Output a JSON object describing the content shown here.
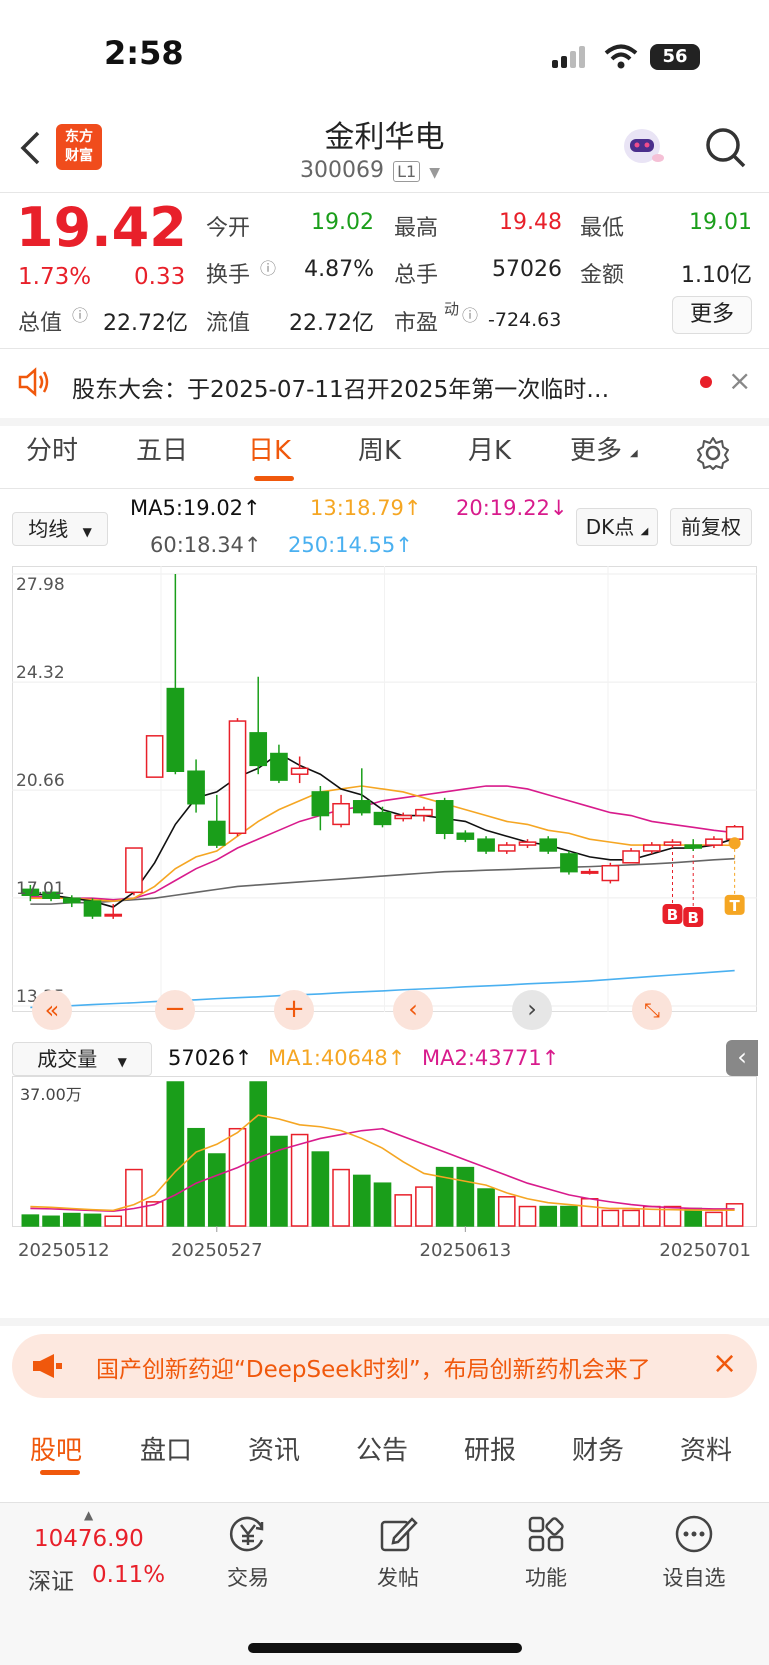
{
  "status_bar": {
    "time": "2:58",
    "battery": "56"
  },
  "header": {
    "title": "金利华电",
    "code": "300069",
    "level": "L1",
    "logo_top": "东方",
    "logo_bottom": "财富"
  },
  "quote": {
    "price": "19.42",
    "change_pct": "1.73%",
    "change": "0.33",
    "open_label": "今开",
    "open": "19.02",
    "high_label": "最高",
    "high": "19.48",
    "low_label": "最低",
    "low": "19.01",
    "turnover_label": "换手",
    "turnover": "4.87%",
    "volume_label": "总手",
    "volume": "57026",
    "amount_label": "金额",
    "amount": "1.10亿",
    "mktcap_label": "总值",
    "mktcap": "22.72亿",
    "float_label": "流值",
    "float_cap": "22.72亿",
    "pe_label": "市盈",
    "pe_sup": "动",
    "pe": "-724.63",
    "more": "更多"
  },
  "notice": {
    "text": "股东大会：于2025-07-11召开2025年第一次临时…"
  },
  "period_tabs": [
    "分时",
    "五日",
    "日K",
    "周K",
    "月K",
    "更多"
  ],
  "ma_controls": {
    "selector": "均线",
    "ma5": "MA5:19.02↑",
    "ma13": "13:18.79↑",
    "ma20": "20:19.22↓",
    "ma60": "60:18.34↑",
    "ma250": "250:14.55↑",
    "dk": "DK点",
    "fq": "前复权"
  },
  "colors": {
    "up": "#e8202a",
    "down": "#1a9e1a",
    "accent": "#f0580c",
    "ma5": "#111111",
    "ma13": "#f5a623",
    "ma20": "#d81b8c",
    "ma60": "#666666",
    "ma250": "#4ab0f0"
  },
  "chart_data": {
    "type": "candlestick",
    "y_ticks": [
      "27.98",
      "24.32",
      "20.66",
      "17.01",
      "13.35"
    ],
    "ylim": [
      13.35,
      27.98
    ],
    "date_labels": [
      "20250512",
      "20250527",
      "20250613",
      "20250701"
    ],
    "candles": [
      {
        "o": 17.3,
        "c": 17.1,
        "h": 17.45,
        "l": 16.9
      },
      {
        "o": 17.2,
        "c": 17.0,
        "h": 17.3,
        "l": 16.9
      },
      {
        "o": 17.0,
        "c": 16.85,
        "h": 17.1,
        "l": 16.7
      },
      {
        "o": 16.9,
        "c": 16.4,
        "h": 17.0,
        "l": 16.3
      },
      {
        "o": 16.4,
        "c": 16.45,
        "h": 16.8,
        "l": 16.3
      },
      {
        "o": 17.2,
        "c": 18.7,
        "h": 18.7,
        "l": 17.1
      },
      {
        "o": 21.1,
        "c": 22.5,
        "h": 22.5,
        "l": 21.1
      },
      {
        "o": 24.1,
        "c": 21.3,
        "h": 27.98,
        "l": 21.2
      },
      {
        "o": 21.3,
        "c": 20.2,
        "h": 21.7,
        "l": 19.9
      },
      {
        "o": 19.6,
        "c": 18.8,
        "h": 20.5,
        "l": 18.7
      },
      {
        "o": 19.2,
        "c": 23.0,
        "h": 23.1,
        "l": 19.1
      },
      {
        "o": 22.6,
        "c": 21.5,
        "h": 24.5,
        "l": 21.2
      },
      {
        "o": 21.9,
        "c": 21.0,
        "h": 22.2,
        "l": 20.9
      },
      {
        "o": 21.2,
        "c": 21.4,
        "h": 21.8,
        "l": 20.9
      },
      {
        "o": 20.6,
        "c": 19.8,
        "h": 20.8,
        "l": 19.3
      },
      {
        "o": 19.5,
        "c": 20.2,
        "h": 20.5,
        "l": 19.4
      },
      {
        "o": 20.3,
        "c": 19.9,
        "h": 21.4,
        "l": 19.8
      },
      {
        "o": 19.9,
        "c": 19.5,
        "h": 20.1,
        "l": 19.4
      },
      {
        "o": 19.7,
        "c": 19.8,
        "h": 19.9,
        "l": 19.6
      },
      {
        "o": 19.8,
        "c": 20.0,
        "h": 20.1,
        "l": 19.6
      },
      {
        "o": 20.3,
        "c": 19.2,
        "h": 20.4,
        "l": 19.0
      },
      {
        "o": 19.2,
        "c": 19.0,
        "h": 19.3,
        "l": 18.9
      },
      {
        "o": 19.0,
        "c": 18.6,
        "h": 19.1,
        "l": 18.5
      },
      {
        "o": 18.6,
        "c": 18.8,
        "h": 18.9,
        "l": 18.5
      },
      {
        "o": 18.8,
        "c": 18.9,
        "h": 19.0,
        "l": 18.7
      },
      {
        "o": 19.0,
        "c": 18.6,
        "h": 19.1,
        "l": 18.5
      },
      {
        "o": 18.5,
        "c": 17.9,
        "h": 18.6,
        "l": 17.8
      },
      {
        "o": 17.9,
        "c": 17.9,
        "h": 18.0,
        "l": 17.8
      },
      {
        "o": 17.6,
        "c": 18.1,
        "h": 18.2,
        "l": 17.5
      },
      {
        "o": 18.2,
        "c": 18.6,
        "h": 18.7,
        "l": 18.2
      },
      {
        "o": 18.6,
        "c": 18.8,
        "h": 18.9,
        "l": 18.5
      },
      {
        "o": 18.8,
        "c": 18.9,
        "h": 19.0,
        "l": 18.7
      },
      {
        "o": 18.8,
        "c": 18.7,
        "h": 19.0,
        "l": 18.6
      },
      {
        "o": 18.8,
        "c": 19.0,
        "h": 19.1,
        "l": 18.7
      },
      {
        "o": 19.0,
        "c": 19.42,
        "h": 19.48,
        "l": 19.01
      }
    ],
    "ma5": [
      17.15,
      17.1,
      17.0,
      16.9,
      16.7,
      17.2,
      18.2,
      19.5,
      20.4,
      20.6,
      21.1,
      21.4,
      21.9,
      21.5,
      21.2,
      20.7,
      20.5,
      20.0,
      19.8,
      19.8,
      19.7,
      19.6,
      19.3,
      19.1,
      18.9,
      18.8,
      18.6,
      18.4,
      18.3,
      18.3,
      18.5,
      18.7,
      18.7,
      18.8,
      19.02
    ],
    "ma13": [
      17.0,
      17.0,
      17.0,
      16.95,
      16.9,
      17.0,
      17.4,
      18.0,
      18.4,
      18.6,
      19.1,
      19.6,
      20.0,
      20.3,
      20.6,
      20.7,
      20.8,
      20.7,
      20.6,
      20.4,
      20.2,
      20.0,
      19.8,
      19.6,
      19.5,
      19.3,
      19.2,
      19.0,
      18.9,
      18.8,
      18.8,
      18.8,
      18.8,
      18.8,
      18.79
    ],
    "ma20": [
      17.05,
      17.05,
      17.0,
      17.0,
      16.95,
      17.0,
      17.2,
      17.6,
      18.0,
      18.3,
      18.7,
      19.0,
      19.3,
      19.6,
      19.8,
      20.0,
      20.1,
      20.3,
      20.4,
      20.5,
      20.6,
      20.7,
      20.8,
      20.8,
      20.7,
      20.5,
      20.3,
      20.1,
      19.9,
      19.8,
      19.6,
      19.5,
      19.4,
      19.3,
      19.22
    ],
    "ma60": [
      16.8,
      16.8,
      16.85,
      16.85,
      16.9,
      16.95,
      17.0,
      17.1,
      17.2,
      17.3,
      17.4,
      17.45,
      17.5,
      17.55,
      17.6,
      17.65,
      17.7,
      17.75,
      17.8,
      17.85,
      17.9,
      17.92,
      17.95,
      17.97,
      18.0,
      18.02,
      18.05,
      18.07,
      18.1,
      18.13,
      18.16,
      18.2,
      18.25,
      18.3,
      18.34
    ],
    "ma250": [
      13.3,
      13.33,
      13.36,
      13.4,
      13.43,
      13.46,
      13.5,
      13.53,
      13.56,
      13.6,
      13.63,
      13.66,
      13.7,
      13.73,
      13.76,
      13.8,
      13.83,
      13.86,
      13.9,
      13.93,
      13.96,
      14.0,
      14.03,
      14.06,
      14.1,
      14.13,
      14.16,
      14.2,
      14.25,
      14.3,
      14.35,
      14.4,
      14.45,
      14.5,
      14.55
    ],
    "volume_label": "37.00万",
    "volume_max": 370000,
    "volumes": [
      28000,
      25000,
      32000,
      30000,
      25000,
      145000,
      62000,
      370000,
      250000,
      185000,
      250000,
      370000,
      230000,
      235000,
      190000,
      145000,
      130000,
      110000,
      80000,
      100000,
      150000,
      150000,
      95000,
      75000,
      50000,
      50000,
      50000,
      70000,
      40000,
      40000,
      50000,
      50000,
      45000,
      35000,
      57026
    ],
    "vol_ma1": [
      50000,
      48000,
      45000,
      42000,
      40000,
      55000,
      80000,
      140000,
      190000,
      210000,
      240000,
      285000,
      275000,
      260000,
      255000,
      245000,
      225000,
      200000,
      165000,
      135000,
      125000,
      115000,
      105000,
      85000,
      70000,
      60000,
      55000,
      50000,
      45000,
      45000,
      43000,
      42000,
      41000,
      40500,
      40648
    ],
    "vol_ma2": [
      45000,
      44000,
      42000,
      40000,
      38000,
      45000,
      55000,
      80000,
      110000,
      130000,
      150000,
      175000,
      195000,
      210000,
      225000,
      235000,
      245000,
      250000,
      230000,
      210000,
      190000,
      170000,
      150000,
      130000,
      110000,
      95000,
      80000,
      70000,
      62000,
      55000,
      50000,
      47000,
      45000,
      44000,
      43771
    ]
  },
  "volume_controls": {
    "selector": "成交量",
    "vol": "57026↑",
    "ma1": "MA1:40648↑",
    "ma2": "MA2:43771↑"
  },
  "ad": {
    "text": "国产创新药迎“DeepSeek时刻”，布局创新药机会来了"
  },
  "sub_tabs": [
    "股吧",
    "盘口",
    "资讯",
    "公告",
    "研报",
    "财务",
    "资料"
  ],
  "index": {
    "value": "10476.90",
    "name": "深证",
    "pct": "0.11%"
  },
  "bottom_nav": [
    "交易",
    "发帖",
    "功能",
    "设自选"
  ],
  "markers": {
    "b1": "B",
    "b2": "B",
    "t": "T"
  }
}
